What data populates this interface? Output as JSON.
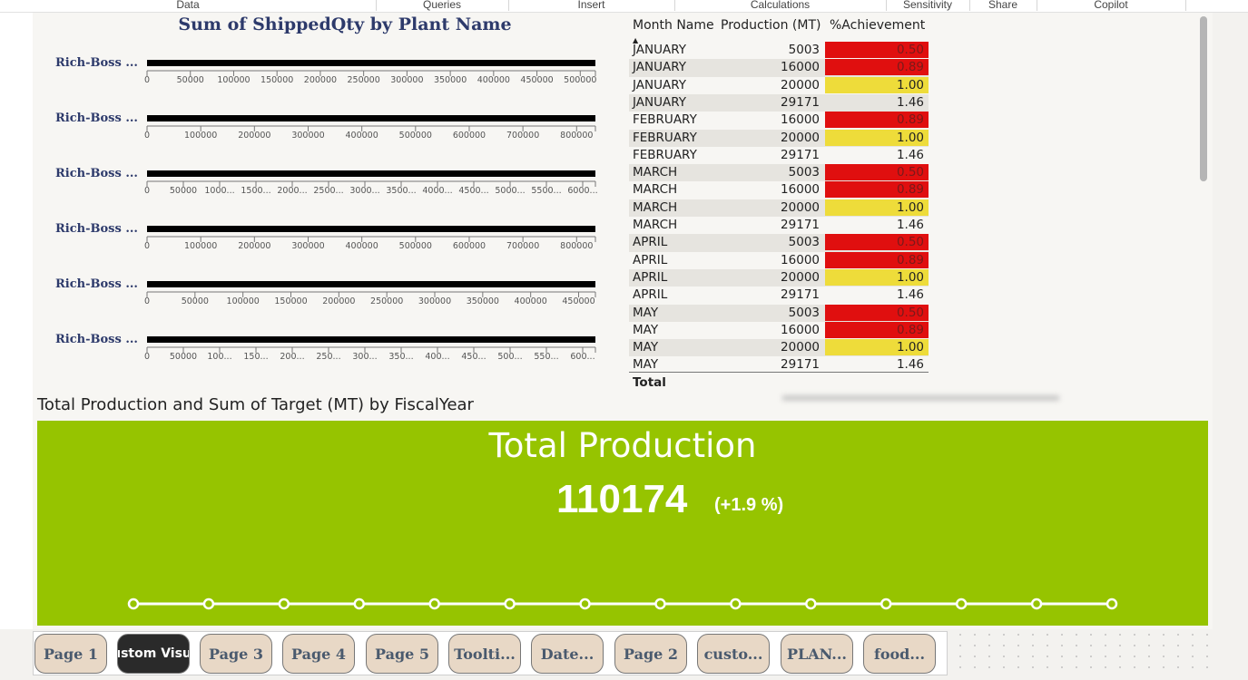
{
  "ribbon": {
    "groups": [
      "Data",
      "Queries",
      "Insert",
      "Calculations",
      "Sensitivity",
      "Share",
      "Copilot"
    ]
  },
  "bullet_chart": {
    "title": "Sum of ShippedQty by Plant Name",
    "rows": [
      {
        "label": "Rich-Boss ...",
        "ticks": [
          "0",
          "50000",
          "100000",
          "150000",
          "200000",
          "250000",
          "300000",
          "350000",
          "400000",
          "450000",
          "500000"
        ],
        "max": 530000,
        "value": 530000
      },
      {
        "label": "Rich-Boss ...",
        "ticks": [
          "0",
          "100000",
          "200000",
          "300000",
          "400000",
          "500000",
          "600000",
          "700000",
          "800000"
        ],
        "max": 800000,
        "value": 800000
      },
      {
        "label": "Rich-Boss ...",
        "ticks": [
          "0",
          "50000",
          "1000...",
          "1500...",
          "2000...",
          "2500...",
          "3000...",
          "3500...",
          "4000...",
          "4500...",
          "5000...",
          "5500...",
          "6000..."
        ],
        "max": 630000,
        "value": 630000
      },
      {
        "label": "Rich-Boss ...",
        "ticks": [
          "0",
          "100000",
          "200000",
          "300000",
          "400000",
          "500000",
          "600000",
          "700000",
          "800000"
        ],
        "max": 890000,
        "value": 890000
      },
      {
        "label": "Rich-Boss ...",
        "ticks": [
          "0",
          "50000",
          "100000",
          "150000",
          "200000",
          "250000",
          "300000",
          "350000",
          "400000",
          "450000"
        ],
        "max": 495000,
        "value": 495000
      },
      {
        "label": "Rich-Boss ...",
        "ticks": [
          "0",
          "50000",
          "100...",
          "150...",
          "200...",
          "250...",
          "300...",
          "350...",
          "400...",
          "450...",
          "500...",
          "550...",
          "600..."
        ],
        "max": 635000,
        "value": 635000
      }
    ]
  },
  "table": {
    "headers": {
      "month": "Month Name",
      "production": "Production (MT)",
      "achievement": "%Achievement"
    },
    "sort_indicator": "▲",
    "rows": [
      {
        "month": "JANUARY",
        "production": "5003",
        "achievement": "0.50",
        "status": "red"
      },
      {
        "month": "JANUARY",
        "production": "16000",
        "achievement": "0.89",
        "status": "red"
      },
      {
        "month": "JANUARY",
        "production": "20000",
        "achievement": "1.00",
        "status": "yellow"
      },
      {
        "month": "JANUARY",
        "production": "29171",
        "achievement": "1.46",
        "status": "none"
      },
      {
        "month": "FEBRUARY",
        "production": "16000",
        "achievement": "0.89",
        "status": "red"
      },
      {
        "month": "FEBRUARY",
        "production": "20000",
        "achievement": "1.00",
        "status": "yellow"
      },
      {
        "month": "FEBRUARY",
        "production": "29171",
        "achievement": "1.46",
        "status": "none"
      },
      {
        "month": "MARCH",
        "production": "5003",
        "achievement": "0.50",
        "status": "red"
      },
      {
        "month": "MARCH",
        "production": "16000",
        "achievement": "0.89",
        "status": "red"
      },
      {
        "month": "MARCH",
        "production": "20000",
        "achievement": "1.00",
        "status": "yellow"
      },
      {
        "month": "MARCH",
        "production": "29171",
        "achievement": "1.46",
        "status": "none"
      },
      {
        "month": "APRIL",
        "production": "5003",
        "achievement": "0.50",
        "status": "red"
      },
      {
        "month": "APRIL",
        "production": "16000",
        "achievement": "0.89",
        "status": "red"
      },
      {
        "month": "APRIL",
        "production": "20000",
        "achievement": "1.00",
        "status": "yellow"
      },
      {
        "month": "APRIL",
        "production": "29171",
        "achievement": "1.46",
        "status": "none"
      },
      {
        "month": "MAY",
        "production": "5003",
        "achievement": "0.50",
        "status": "red"
      },
      {
        "month": "MAY",
        "production": "16000",
        "achievement": "0.89",
        "status": "red"
      },
      {
        "month": "MAY",
        "production": "20000",
        "achievement": "1.00",
        "status": "yellow"
      },
      {
        "month": "MAY",
        "production": "29171",
        "achievement": "1.46",
        "status": "none"
      }
    ],
    "total_label": "Total"
  },
  "kpi": {
    "section_title": "Total Production and Sum of Target (MT) by FiscalYear",
    "label": "Total Production",
    "value": "110174",
    "delta": "(+1.9 %)",
    "trend_points": 14
  },
  "tabs": [
    "Page 1",
    "Custom Visual",
    "Page 3",
    "Page 4",
    "Page 5",
    "Toolti...",
    "Date...",
    "Page 2",
    "custo...",
    "PLAN...",
    "food..."
  ],
  "active_tab": 1,
  "colors": {
    "red": "#e00f0f",
    "yellow": "#eedc3a",
    "kpi_green": "#96c400",
    "row_alt": "#e6e4df",
    "title_navy": "#2d3a6b",
    "tab_bg": "#e8d8c6",
    "tab_active_bg": "#2a2a2a"
  }
}
